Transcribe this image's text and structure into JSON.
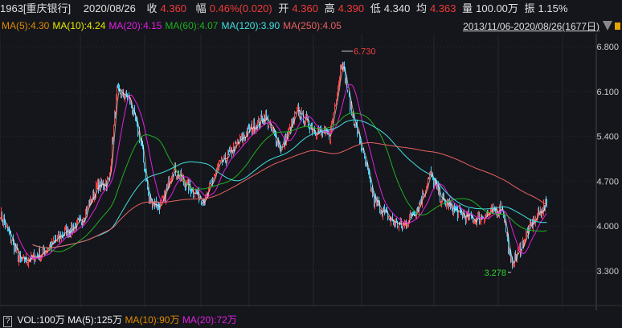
{
  "header": {
    "code": "1963[重庆银行]",
    "date": "2020/08/26",
    "close_label": "收",
    "close": "4.360",
    "change_label": "幅",
    "change": "0.46%(0.020)",
    "open_label": "开",
    "open": "4.360",
    "high_label": "高",
    "high": "4.390",
    "low_label": "低",
    "low": "4.340",
    "avg_label": "均",
    "avg": "4.363",
    "vol_label": "量",
    "vol": "100.00万",
    "amp_label": "振",
    "amp": "1.15%"
  },
  "ma_legend": [
    {
      "text": "MA(5):4.30",
      "color": "#e08a00"
    },
    {
      "text": "MA(10):4.24",
      "color": "#e8e800"
    },
    {
      "text": "MA(20):4.15",
      "color": "#e020e0"
    },
    {
      "text": "MA(60):4.07",
      "color": "#20b020"
    },
    {
      "text": "MA(120):3.90",
      "color": "#40e0e0"
    },
    {
      "text": "MA(250):4.05",
      "color": "#e86060"
    }
  ],
  "range": "2013/11/06-2020/08/26(1677日)",
  "volume_legend": {
    "help": "?",
    "vol": "VOL:100万",
    "ma5": "MA(5):125万",
    "ma10": "MA(10):90万",
    "ma20": "MA(20):72万"
  },
  "chart_data": {
    "type": "candlestick",
    "y_ticks": [
      "6.800",
      "6.100",
      "5.400",
      "4.700",
      "4.000",
      "3.300"
    ],
    "ylim": [
      3.3,
      6.8
    ],
    "annotations": [
      {
        "text": "6.730",
        "value": 6.73,
        "color": "#f04040"
      },
      {
        "text": "3.278",
        "value": 3.278,
        "color": "#30d030"
      }
    ],
    "approx_close_path": [
      [
        0,
        4.2
      ],
      [
        25,
        3.45
      ],
      [
        50,
        3.55
      ],
      [
        80,
        3.9
      ],
      [
        100,
        4.05
      ],
      [
        120,
        4.6
      ],
      [
        135,
        4.7
      ],
      [
        145,
        6.1
      ],
      [
        160,
        6.0
      ],
      [
        175,
        5.3
      ],
      [
        185,
        4.4
      ],
      [
        200,
        4.3
      ],
      [
        215,
        4.9
      ],
      [
        235,
        4.6
      ],
      [
        255,
        4.4
      ],
      [
        270,
        4.9
      ],
      [
        290,
        5.2
      ],
      [
        310,
        5.5
      ],
      [
        330,
        5.7
      ],
      [
        350,
        5.2
      ],
      [
        370,
        5.8
      ],
      [
        390,
        5.5
      ],
      [
        410,
        5.4
      ],
      [
        425,
        6.6
      ],
      [
        435,
        5.9
      ],
      [
        450,
        5.2
      ],
      [
        465,
        4.4
      ],
      [
        485,
        4.1
      ],
      [
        500,
        4.0
      ],
      [
        520,
        4.3
      ],
      [
        535,
        4.8
      ],
      [
        550,
        4.4
      ],
      [
        570,
        4.2
      ],
      [
        590,
        4.1
      ],
      [
        610,
        4.2
      ],
      [
        625,
        4.3
      ],
      [
        635,
        3.4
      ],
      [
        645,
        3.6
      ],
      [
        660,
        4.0
      ],
      [
        670,
        4.2
      ],
      [
        680,
        4.36
      ]
    ]
  }
}
